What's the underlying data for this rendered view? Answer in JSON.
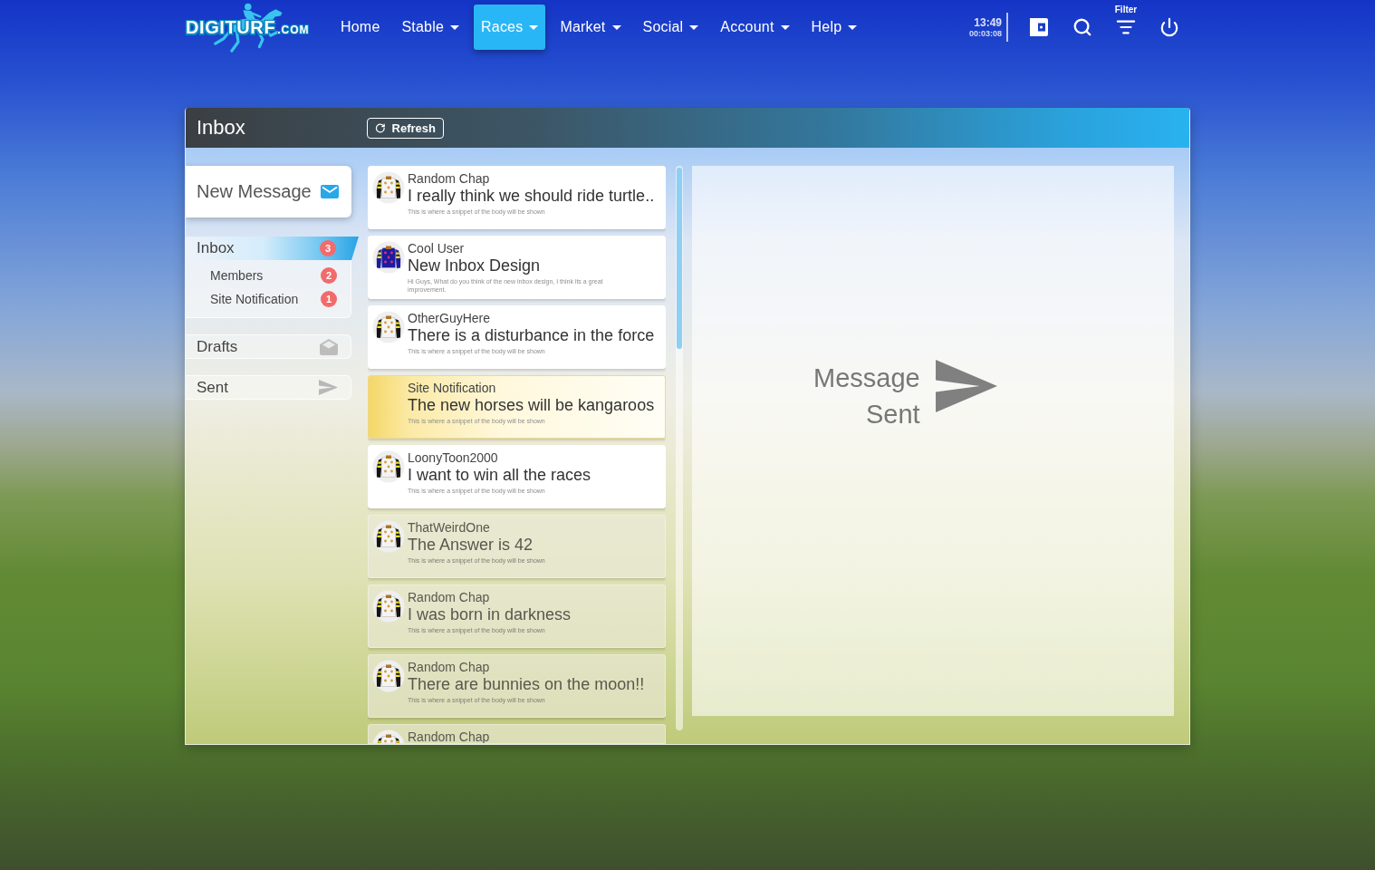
{
  "nav": {
    "logo": {
      "name": "DIGITURF",
      "suffix": ".COM"
    },
    "items": [
      {
        "label": "Home",
        "dropdown": false,
        "selected": false
      },
      {
        "label": "Stable",
        "dropdown": true,
        "selected": false
      },
      {
        "label": "Races",
        "dropdown": true,
        "selected": true
      },
      {
        "label": "Market",
        "dropdown": true,
        "selected": false
      },
      {
        "label": "Social",
        "dropdown": true,
        "selected": false
      },
      {
        "label": "Account",
        "dropdown": true,
        "selected": false
      },
      {
        "label": "Help",
        "dropdown": true,
        "selected": false
      }
    ],
    "clock": {
      "time": "13:49",
      "elapsed": "00:03:08"
    },
    "filter_label": "Filter"
  },
  "panel": {
    "title": "Inbox",
    "refresh": "Refresh"
  },
  "sidebar": {
    "new_message": "New Message",
    "folders": [
      {
        "kind": "inbox",
        "label": "Inbox",
        "badge": "3",
        "selected": true,
        "children": [
          {
            "label": "Members",
            "badge": "2",
            "selected": false
          },
          {
            "label": "Site Notification",
            "badge": "1",
            "selected": false
          }
        ]
      },
      {
        "kind": "drafts",
        "label": "Drafts",
        "selected": false
      },
      {
        "kind": "sent",
        "label": "Sent",
        "selected": false
      }
    ]
  },
  "messages": [
    {
      "kind": "message",
      "sender": "Random Chap",
      "subject": "I really think we should ride turtle..",
      "snippet": "This is where a snippet of the body will be shown",
      "read": false,
      "color": "#f4f4f4"
    },
    {
      "kind": "message",
      "sender": "Cool User",
      "subject": "New Inbox Design",
      "snippet": "Hi Guys, What do you think of the new inbox design, I think its a great improvement.",
      "read": false,
      "color": "#1c1ca0"
    },
    {
      "kind": "message",
      "sender": "OtherGuyHere",
      "subject": "There is a disturbance in the force",
      "snippet": "This is where a snippet of the body will be shown",
      "read": false,
      "color": "#f4f4f4"
    },
    {
      "kind": "notification",
      "sender": "Site Notification",
      "subject": "The new horses will be kangaroos",
      "snippet": "This is where a snippet of the body will be shown",
      "read": false
    },
    {
      "kind": "message",
      "sender": "LoonyToon2000",
      "subject": "I want to win all the races",
      "snippet": "This is where a snippet of the body will be shown",
      "read": false,
      "color": "#f4f4f4"
    },
    {
      "kind": "message",
      "sender": "ThatWeirdOne",
      "subject": "The Answer is 42",
      "snippet": "This is where a snippet of the body will be shown",
      "read": true,
      "color": "#f4f4f4"
    },
    {
      "kind": "message",
      "sender": "Random Chap",
      "subject": "I was born in darkness",
      "snippet": "This is where a snippet of the body will be shown",
      "read": true,
      "color": "#f4f4f4"
    },
    {
      "kind": "message",
      "sender": "Random Chap",
      "subject": "There are bunnies on the moon!!",
      "snippet": "This is where a snippet of the body will be shown",
      "read": true,
      "color": "#f4f4f4"
    },
    {
      "kind": "message",
      "sender": "Random Chap",
      "read": true,
      "color": "#f4f4f4"
    }
  ],
  "detail": {
    "status": "Message Sent"
  }
}
